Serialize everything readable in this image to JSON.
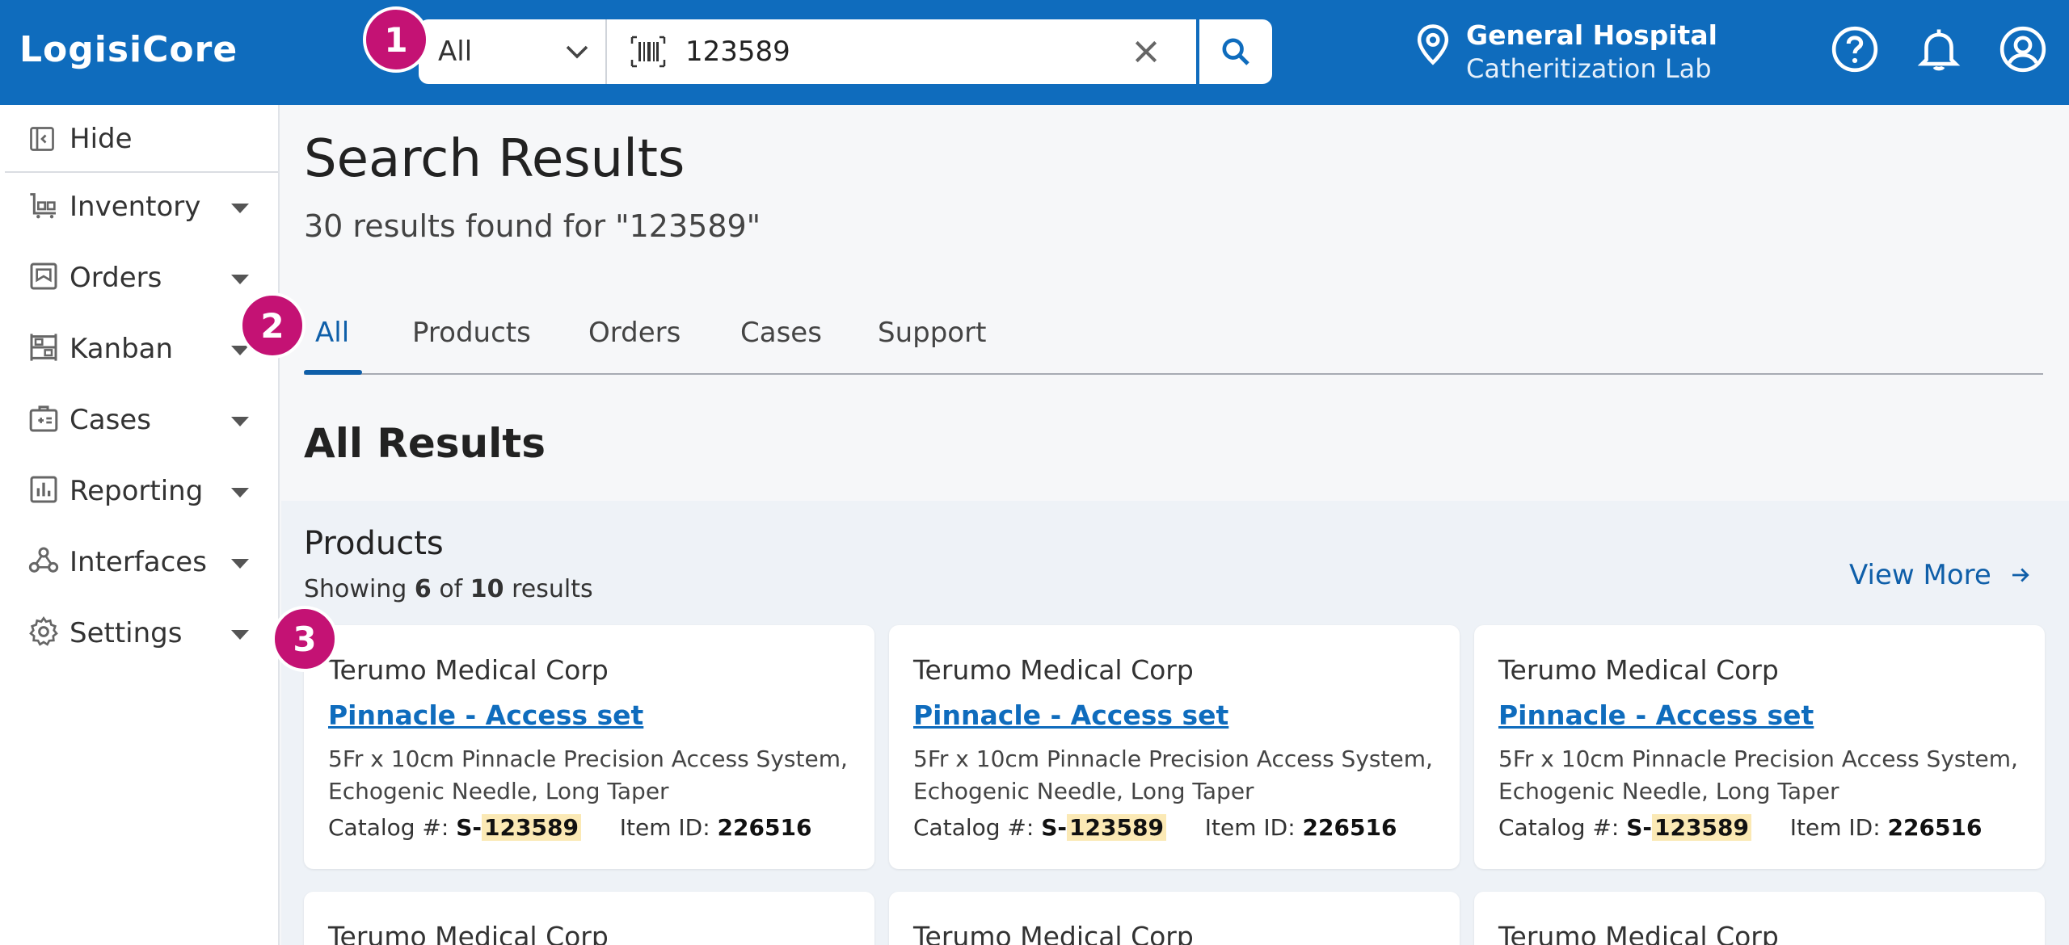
{
  "app": {
    "brand": "LogisiCore"
  },
  "search": {
    "scope": "All",
    "query": "123589"
  },
  "location": {
    "name": "General Hospital",
    "department": "Catheritization Lab"
  },
  "badges": [
    "1",
    "2",
    "3"
  ],
  "sidebar": {
    "hide_label": "Hide",
    "items": [
      {
        "label": "Inventory",
        "icon": "inventory-icon"
      },
      {
        "label": "Orders",
        "icon": "orders-icon"
      },
      {
        "label": "Kanban",
        "icon": "kanban-icon"
      },
      {
        "label": "Cases",
        "icon": "cases-icon"
      },
      {
        "label": "Reporting",
        "icon": "reporting-icon"
      },
      {
        "label": "Interfaces",
        "icon": "interfaces-icon"
      },
      {
        "label": "Settings",
        "icon": "settings-icon"
      }
    ]
  },
  "main": {
    "title": "Search Results",
    "subtitle": "30 results found for \"123589\"",
    "tabs": [
      {
        "label": "All",
        "active": true
      },
      {
        "label": "Products"
      },
      {
        "label": "Orders"
      },
      {
        "label": "Cases"
      },
      {
        "label": "Support"
      }
    ],
    "section_title": "All Results"
  },
  "products": {
    "title": "Products",
    "showing_prefix": "Showing",
    "showing_count": "6",
    "showing_mid": "of",
    "showing_total": "10",
    "showing_suffix": "results",
    "view_more": "View More",
    "catalog_label": "Catalog #:",
    "item_label": "Item ID:",
    "cards": [
      {
        "manufacturer": "Terumo Medical Corp",
        "name": "Pinnacle - Access set",
        "desc_line1": "5Fr x 10cm Pinnacle Precision Access System,",
        "desc_line2": "Echogenic Needle, Long Taper",
        "catalog_prefix": "S-",
        "catalog_match": "123589",
        "item_id": "226516"
      },
      {
        "manufacturer": "Terumo Medical Corp",
        "name": "Pinnacle - Access set",
        "desc_line1": "5Fr x 10cm Pinnacle Precision Access System,",
        "desc_line2": "Echogenic Needle, Long Taper",
        "catalog_prefix": "S-",
        "catalog_match": "123589",
        "item_id": "226516"
      },
      {
        "manufacturer": "Terumo Medical Corp",
        "name": "Pinnacle - Access set",
        "desc_line1": "5Fr x 10cm Pinnacle Precision Access System,",
        "desc_line2": "Echogenic Needle, Long Taper",
        "catalog_prefix": "S-",
        "catalog_match": "123589",
        "item_id": "226516"
      },
      {
        "manufacturer": "Terumo Medical Corp"
      },
      {
        "manufacturer": "Terumo Medical Corp"
      },
      {
        "manufacturer": "Terumo Medical Corp"
      }
    ]
  },
  "colors": {
    "brand_blue": "#0f6cbd",
    "badge_magenta": "#c41274",
    "highlight": "#fbe9b5"
  }
}
